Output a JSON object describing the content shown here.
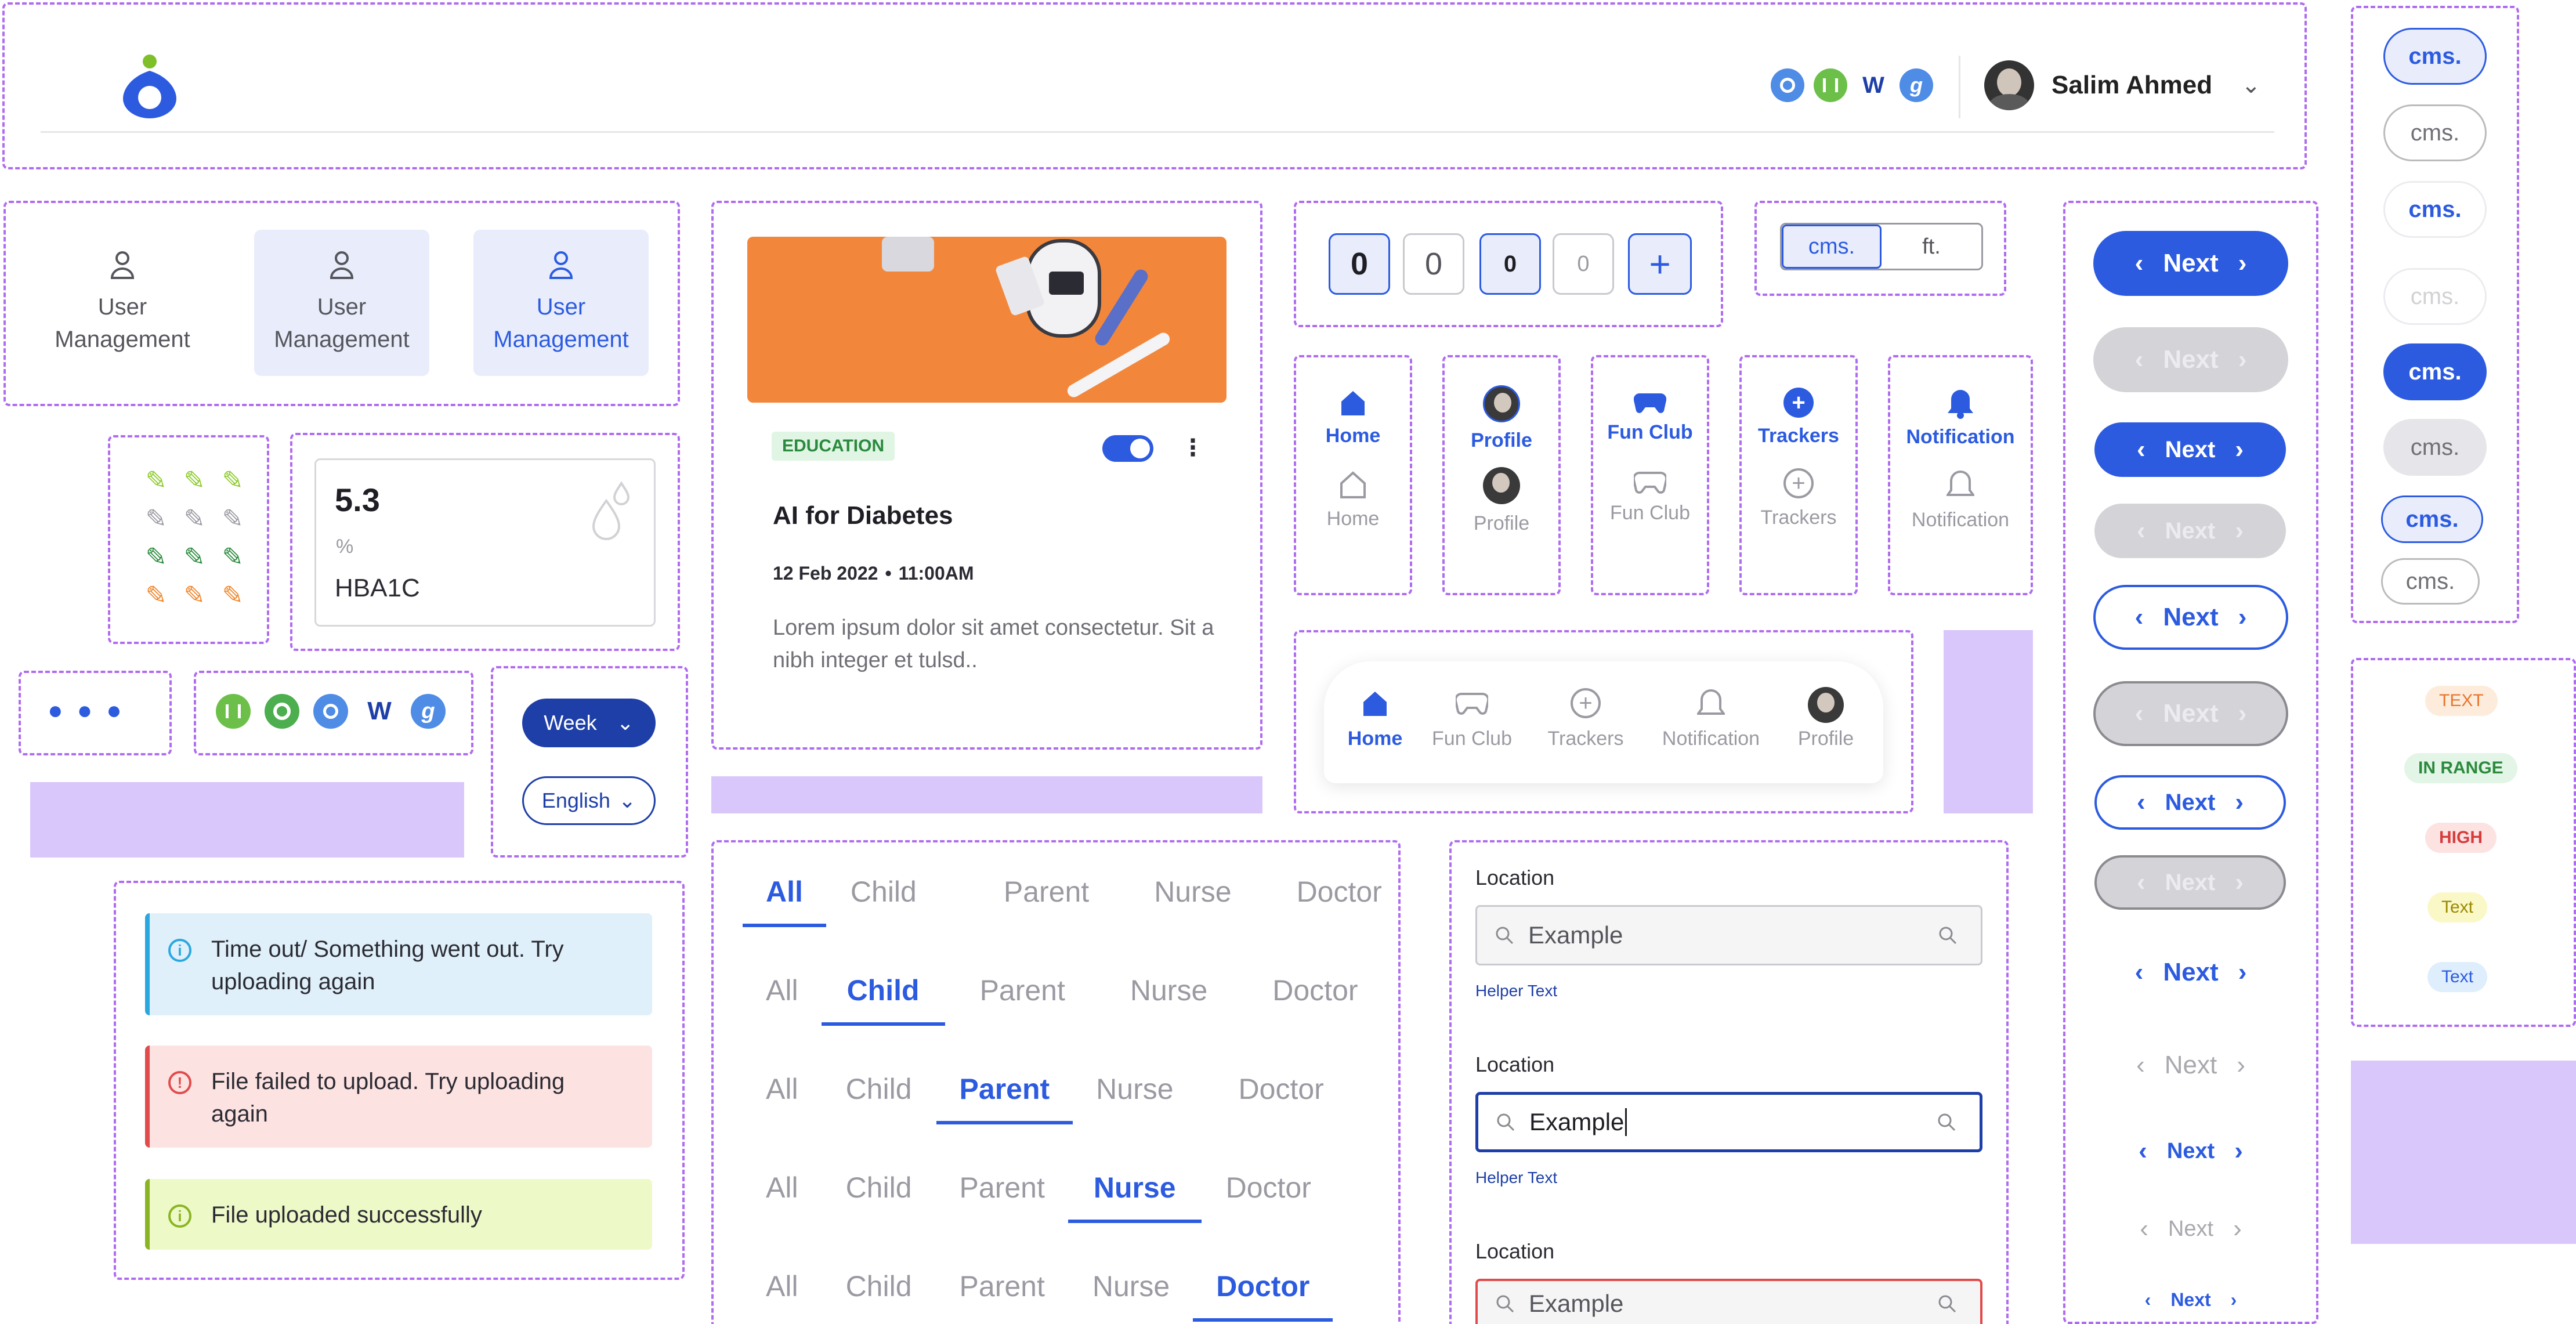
{
  "header": {
    "user_name": "Salim Ahmed",
    "app_icons": [
      "clock-app-icon",
      "chart-app-icon",
      "w-app-icon",
      "g-app-icon"
    ]
  },
  "user_management": {
    "tiles": [
      {
        "label": "User Management",
        "state": "default"
      },
      {
        "label": "User Management",
        "state": "hover"
      },
      {
        "label": "User Management",
        "state": "active"
      }
    ]
  },
  "hba1c": {
    "value": "5.3",
    "unit": "%",
    "label": "HBA1C"
  },
  "dropdowns": {
    "week": "Week",
    "language": "English"
  },
  "article": {
    "tag": "EDUCATION",
    "title": "AI for Diabetes",
    "date": "12 Feb 2022",
    "time": "11:00AM",
    "body": "Lorem ipsum dolor sit amet consectetur. Sit a nibh integer et tulsd..",
    "toggle_on": true
  },
  "counters": [
    "0",
    "0",
    "0",
    "0"
  ],
  "unit_toggle": {
    "left": "cms.",
    "right": "ft."
  },
  "nav_items": [
    {
      "label": "Home",
      "icon": "home-icon"
    },
    {
      "label": "Profile",
      "icon": "avatar"
    },
    {
      "label": "Fun Club",
      "icon": "gamepad-icon"
    },
    {
      "label": "Trackers",
      "icon": "plus-circle-icon"
    },
    {
      "label": "Notification",
      "icon": "bell-icon"
    }
  ],
  "bottom_nav": [
    "Home",
    "Fun Club",
    "Trackers",
    "Notification",
    "Profile"
  ],
  "next_label": "Next",
  "cms_label": "cms.",
  "tabs": [
    "All",
    "Child",
    "Parent",
    "Nurse",
    "Doctor"
  ],
  "alerts": [
    {
      "text": "Time out/ Something went out. Try uploading again",
      "kind": "info"
    },
    {
      "text": "File failed to upload. Try uploading again",
      "kind": "error"
    },
    {
      "text": "File uploaded successfully",
      "kind": "success"
    }
  ],
  "form": {
    "label": "Location",
    "placeholder": "Example",
    "helper": "Helper Text"
  },
  "badges": [
    {
      "text": "TEXT",
      "color": "#e8762c",
      "bg": "#fdecdc"
    },
    {
      "text": "IN RANGE",
      "color": "#2b8a3e",
      "bg": "#e3f5e6"
    },
    {
      "text": "HIGH",
      "color": "#d63c3c",
      "bg": "#fde2e2"
    },
    {
      "text": "Text",
      "color": "#9a8a00",
      "bg": "#fbf8c8"
    },
    {
      "text": "Text",
      "color": "#2c5be0",
      "bg": "#dfeefc"
    }
  ],
  "colors": {
    "primary": "#2c5be0",
    "accent_dash": "#b06cf0",
    "lavender": "#d9c7fb"
  }
}
